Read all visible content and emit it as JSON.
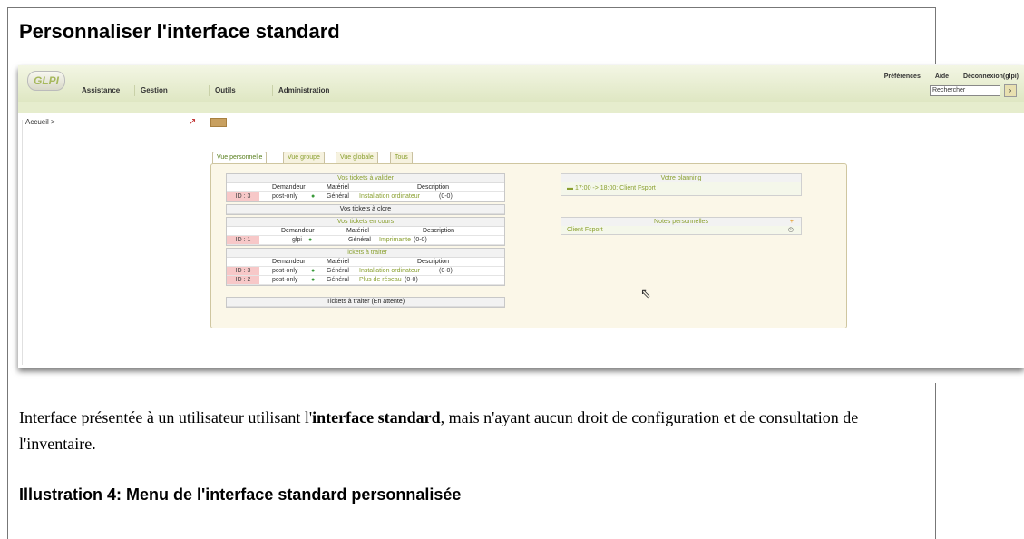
{
  "heading": "Personnaliser l'interface standard",
  "screenshot": {
    "logo": "GLPI",
    "menu": [
      "Assistance",
      "Gestion",
      "Outils",
      "Administration"
    ],
    "top_links": [
      "Préférences",
      "Aide",
      "Déconnexion(glpi)"
    ],
    "search_placeholder": "Rechercher",
    "breadcrumb": "Accueil >",
    "tabs": [
      "Vue personnelle",
      "Vue groupe",
      "Vue globale",
      "Tous"
    ],
    "tickets_to_validate": {
      "title": "Vos tickets à valider",
      "headers": [
        "Demandeur",
        "Matériel",
        "Description"
      ],
      "rows": [
        {
          "id": "ID : 3",
          "requester": "post-only",
          "item": "Général",
          "desc": "Installation ordinateur",
          "count": "(0-0)"
        }
      ]
    },
    "tickets_to_close": {
      "title": "Vos tickets à clore"
    },
    "tickets_in_progress": {
      "title": "Vos tickets en cours",
      "headers": [
        "Demandeur",
        "Matériel",
        "Description"
      ],
      "rows": [
        {
          "id": "ID : 1",
          "requester": "glpi",
          "item": "Général",
          "desc": "Imprimante",
          "count": "(0-0)"
        }
      ]
    },
    "tickets_to_process": {
      "title": "Tickets à traiter",
      "headers": [
        "Demandeur",
        "Matériel",
        "Description"
      ],
      "rows": [
        {
          "id": "ID : 3",
          "requester": "post-only",
          "item": "Général",
          "desc": "Installation ordinateur",
          "count": "(0-0)"
        },
        {
          "id": "ID : 2",
          "requester": "post-only",
          "item": "Général",
          "desc": "Plus de réseau",
          "count": "(0-0)"
        }
      ]
    },
    "tickets_waiting": {
      "title": "Tickets à traiter (En attente)"
    },
    "planning": {
      "title": "Votre planning",
      "entry": "17:00 -> 18:00: Client Fsport"
    },
    "notes": {
      "title": "Notes personnelles",
      "entry": "Client Fsport"
    }
  },
  "caption": {
    "before": "Interface présentée à un utilisateur utilisant l'",
    "bold": "interface standard",
    "after": ", mais n'ayant aucun droit de configuration et de consultation de l'inventaire."
  },
  "illustration": "Illustration 4: Menu de l'interface standard personnalisée"
}
